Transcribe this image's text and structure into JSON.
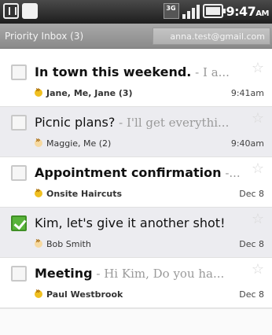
{
  "status_bar": {
    "time": "9:47",
    "ampm": "AM",
    "network_type": "3G"
  },
  "header": {
    "title": "Priority Inbox (3)",
    "account": "anna.test@gmail.com"
  },
  "messages": [
    {
      "subject": "In town this weekend.",
      "snippet": " - I a...",
      "senders_prefix": "Jane, Me, ",
      "senders_bold": "Jane",
      "count": " (3)",
      "date": "9:41am",
      "read": false,
      "checked": false,
      "starred": false
    },
    {
      "subject": "Picnic plans?",
      "snippet": " - I'll get everythi...",
      "senders_prefix": "Maggie, Me (2)",
      "senders_bold": "",
      "count": "",
      "date": "9:40am",
      "read": true,
      "checked": false,
      "starred": false
    },
    {
      "subject": "Appointment confirmation",
      "snippet": " -...",
      "senders_prefix": "",
      "senders_bold": "Onsite Haircuts",
      "count": "",
      "date": "Dec 8",
      "read": false,
      "checked": false,
      "starred": false
    },
    {
      "subject": "Kim, let's give it another shot!",
      "snippet": "",
      "senders_prefix": "Bob Smith",
      "senders_bold": "",
      "count": "",
      "date": "Dec 8",
      "read": true,
      "checked": true,
      "starred": false
    },
    {
      "subject": "Meeting",
      "snippet": " - Hi Kim, Do you ha...",
      "senders_prefix": "",
      "senders_bold": "Paul Westbrook",
      "count": "",
      "date": "Dec 8",
      "read": false,
      "checked": false,
      "starred": false
    }
  ],
  "icons": {
    "star": "star-icon",
    "checkbox": "checkbox",
    "importance": "importance-marker-icon"
  },
  "colors": {
    "unread_bg": "#ffffff",
    "read_bg": "#ececf0",
    "check_green": "#58b33a",
    "marker_yellow": "#f0c020"
  }
}
